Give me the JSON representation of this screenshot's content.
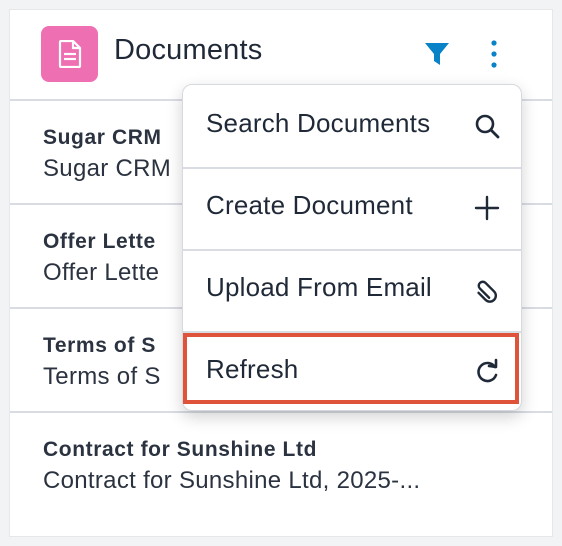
{
  "header": {
    "title": "Documents",
    "icon": "document-icon",
    "tile_color": "#ef6fb3",
    "accent_color": "#0a82c8"
  },
  "rows": [
    {
      "name": "Sugar CRM",
      "sub": "Sugar CRM"
    },
    {
      "name": "Offer Lette",
      "sub": "Offer Lette"
    },
    {
      "name": "Terms of S",
      "sub": "Terms of S"
    },
    {
      "name": "Contract for Sunshine Ltd",
      "sub": "Contract for Sunshine Ltd, 2025-..."
    }
  ],
  "menu": {
    "items": [
      {
        "label": "Search Documents",
        "icon": "search-icon"
      },
      {
        "label": "Create Document",
        "icon": "plus-icon"
      },
      {
        "label": "Upload From Email",
        "icon": "paperclip-icon"
      },
      {
        "label": "Refresh",
        "icon": "refresh-icon"
      }
    ],
    "highlighted": "Refresh",
    "highlight_color": "#e0533b"
  }
}
